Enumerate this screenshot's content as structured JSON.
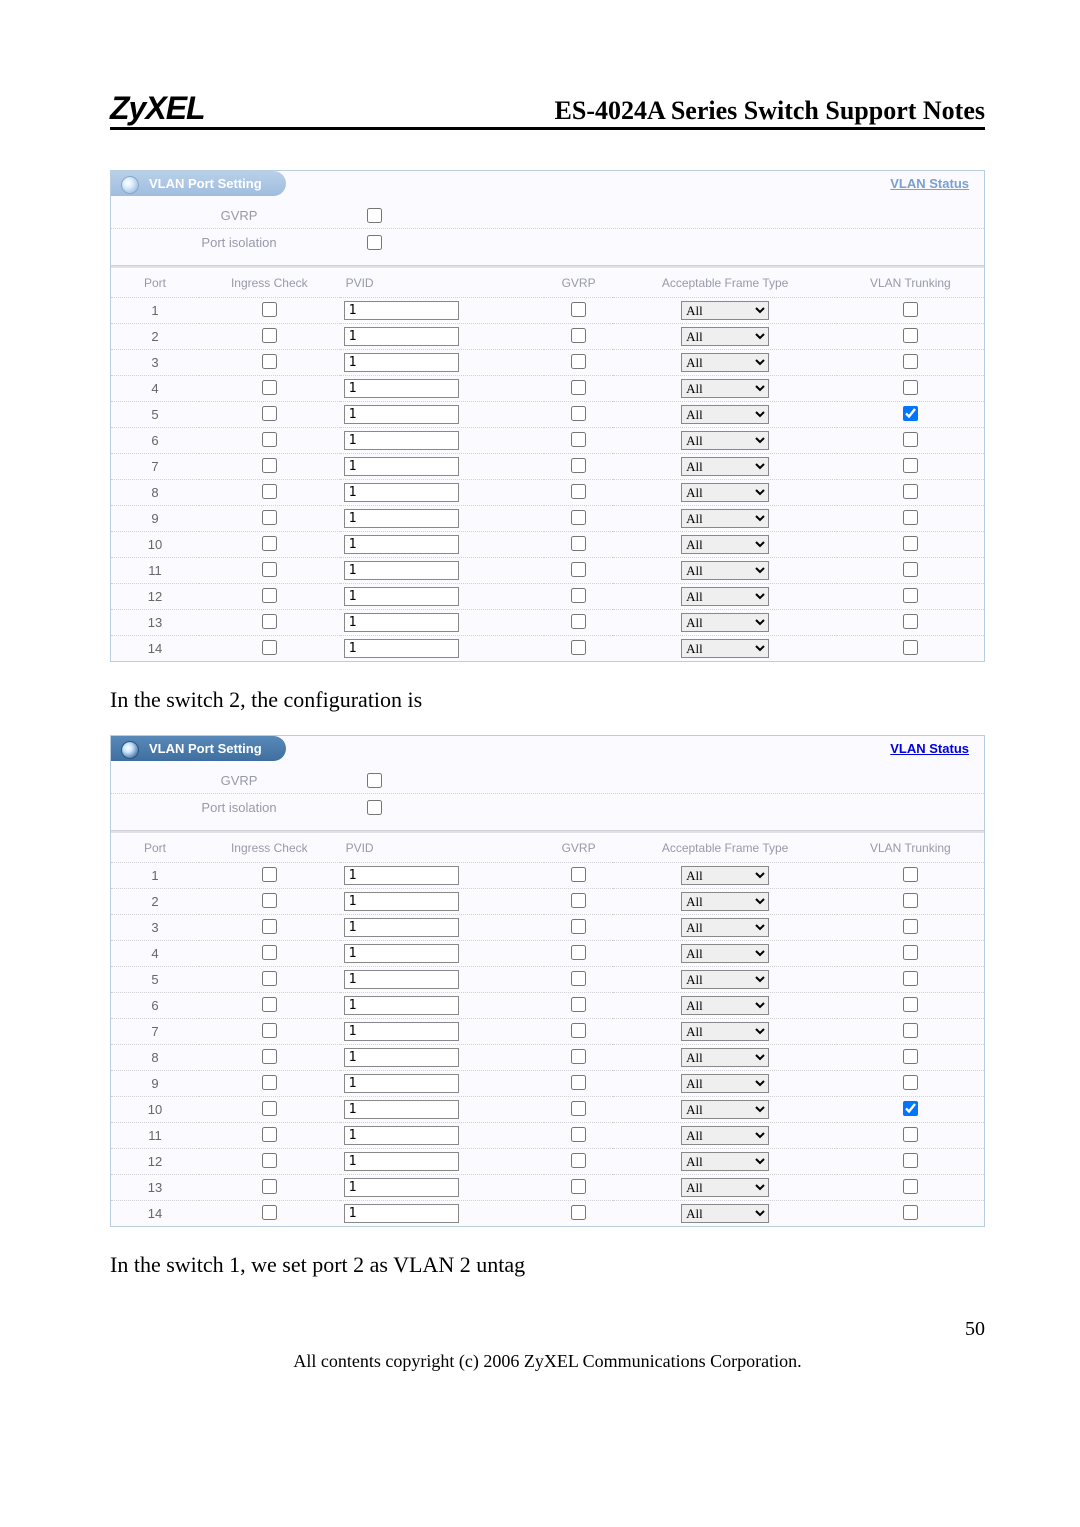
{
  "header": {
    "logo": "ZyXEL",
    "title": "ES-4024A Series Switch Support Notes"
  },
  "labels": {
    "tab": "VLAN Port Setting",
    "status": "VLAN Status",
    "gvrp": "GVRP",
    "iso": "Port isolation"
  },
  "cols": {
    "port": "Port",
    "ing": "Ingress Check",
    "pvid": "PVID",
    "gvrp": "GVRP",
    "aft": "Acceptable Frame Type",
    "trunk": "VLAN Trunking"
  },
  "t1": [
    {
      "p": "1",
      "i": false,
      "v": "1",
      "g": false,
      "f": "All",
      "t": false
    },
    {
      "p": "2",
      "i": false,
      "v": "1",
      "g": false,
      "f": "All",
      "t": false
    },
    {
      "p": "3",
      "i": false,
      "v": "1",
      "g": false,
      "f": "All",
      "t": false
    },
    {
      "p": "4",
      "i": false,
      "v": "1",
      "g": false,
      "f": "All",
      "t": false
    },
    {
      "p": "5",
      "i": false,
      "v": "1",
      "g": false,
      "f": "All",
      "t": true
    },
    {
      "p": "6",
      "i": false,
      "v": "1",
      "g": false,
      "f": "All",
      "t": false
    },
    {
      "p": "7",
      "i": false,
      "v": "1",
      "g": false,
      "f": "All",
      "t": false
    },
    {
      "p": "8",
      "i": false,
      "v": "1",
      "g": false,
      "f": "All",
      "t": false
    },
    {
      "p": "9",
      "i": false,
      "v": "1",
      "g": false,
      "f": "All",
      "t": false
    },
    {
      "p": "10",
      "i": false,
      "v": "1",
      "g": false,
      "f": "All",
      "t": false
    },
    {
      "p": "11",
      "i": false,
      "v": "1",
      "g": false,
      "f": "All",
      "t": false
    },
    {
      "p": "12",
      "i": false,
      "v": "1",
      "g": false,
      "f": "All",
      "t": false
    },
    {
      "p": "13",
      "i": false,
      "v": "1",
      "g": false,
      "f": "All",
      "t": false
    },
    {
      "p": "14",
      "i": false,
      "v": "1",
      "g": false,
      "f": "All",
      "t": false
    }
  ],
  "text1": "In the switch 2, the configuration is",
  "t2": [
    {
      "p": "1",
      "i": false,
      "v": "1",
      "g": false,
      "f": "All",
      "t": false
    },
    {
      "p": "2",
      "i": false,
      "v": "1",
      "g": false,
      "f": "All",
      "t": false
    },
    {
      "p": "3",
      "i": false,
      "v": "1",
      "g": false,
      "f": "All",
      "t": false
    },
    {
      "p": "4",
      "i": false,
      "v": "1",
      "g": false,
      "f": "All",
      "t": false
    },
    {
      "p": "5",
      "i": false,
      "v": "1",
      "g": false,
      "f": "All",
      "t": false
    },
    {
      "p": "6",
      "i": false,
      "v": "1",
      "g": false,
      "f": "All",
      "t": false
    },
    {
      "p": "7",
      "i": false,
      "v": "1",
      "g": false,
      "f": "All",
      "t": false
    },
    {
      "p": "8",
      "i": false,
      "v": "1",
      "g": false,
      "f": "All",
      "t": false
    },
    {
      "p": "9",
      "i": false,
      "v": "1",
      "g": false,
      "f": "All",
      "t": false
    },
    {
      "p": "10",
      "i": false,
      "v": "1",
      "g": false,
      "f": "All",
      "t": true
    },
    {
      "p": "11",
      "i": false,
      "v": "1",
      "g": false,
      "f": "All",
      "t": false
    },
    {
      "p": "12",
      "i": false,
      "v": "1",
      "g": false,
      "f": "All",
      "t": false
    },
    {
      "p": "13",
      "i": false,
      "v": "1",
      "g": false,
      "f": "All",
      "t": false
    },
    {
      "p": "14",
      "i": false,
      "v": "1",
      "g": false,
      "f": "All",
      "t": false
    }
  ],
  "text2": "In the switch 1, we set port 2 as VLAN 2 untag",
  "pagenum": "50",
  "copyright": "All contents copyright (c) 2006 ZyXEL Communications Corporation."
}
